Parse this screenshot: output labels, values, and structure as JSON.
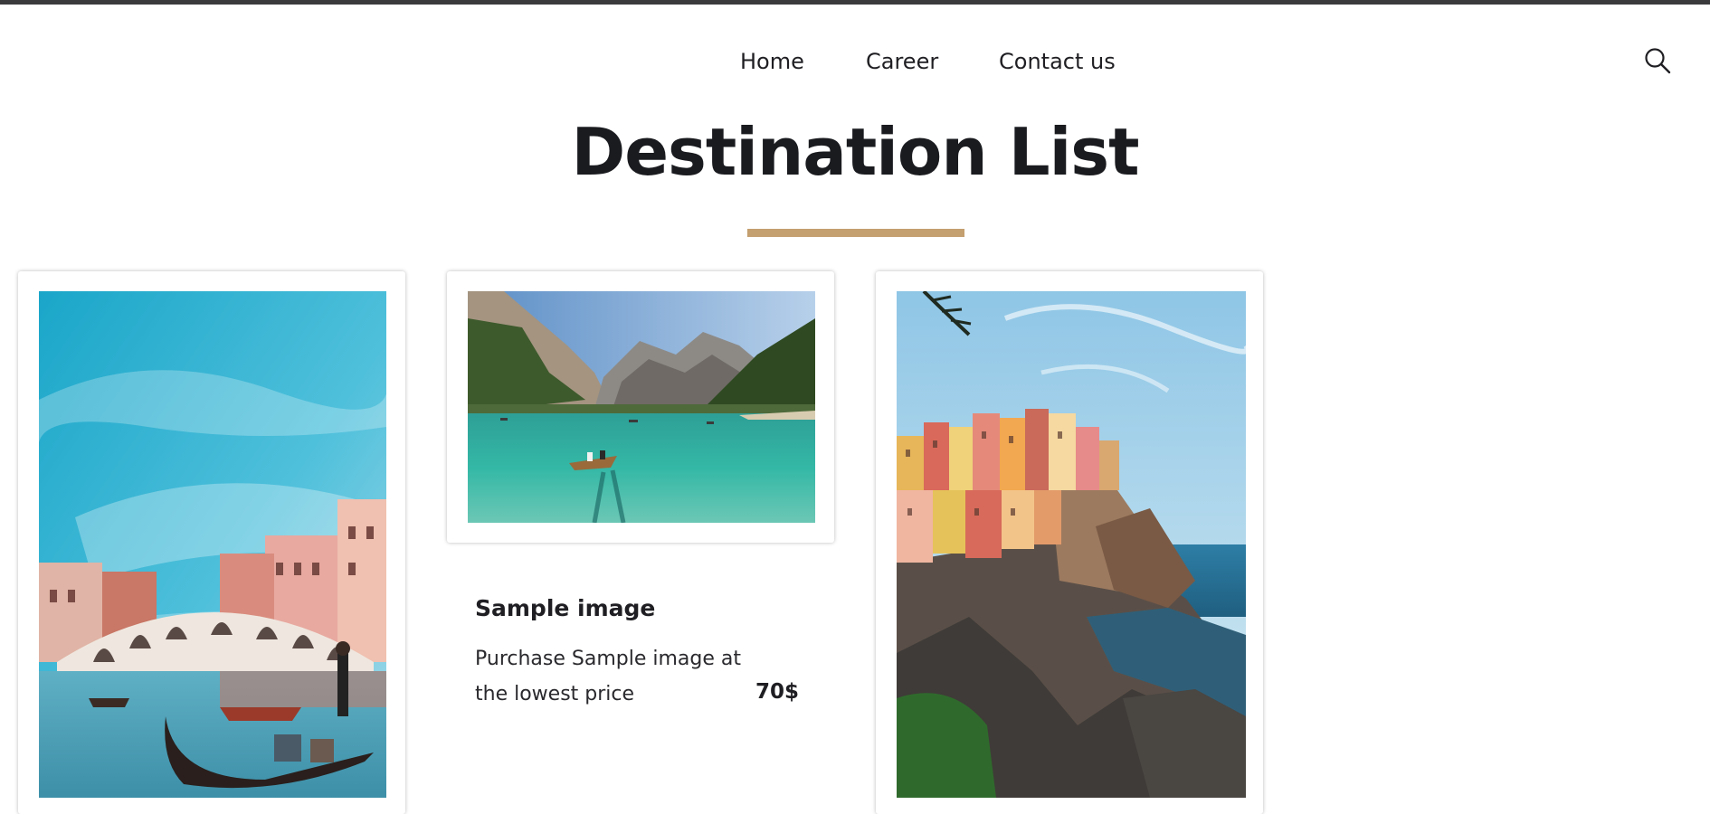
{
  "nav": {
    "items": [
      {
        "label": "Home"
      },
      {
        "label": "Career"
      },
      {
        "label": "Contact us"
      }
    ],
    "search_icon": "search-icon"
  },
  "page": {
    "title": "Destination List",
    "accent_color": "#c49f6f"
  },
  "cards": [
    {
      "image": "venice-rialto-bridge-gondola-photo"
    },
    {
      "image": "mountain-lake-rowboat-photo"
    },
    {
      "image": "cinque-terre-cliff-village-photo"
    }
  ],
  "featured": {
    "title": "Sample image",
    "description": "Purchase Sample image at the lowest price",
    "price": "70$"
  }
}
